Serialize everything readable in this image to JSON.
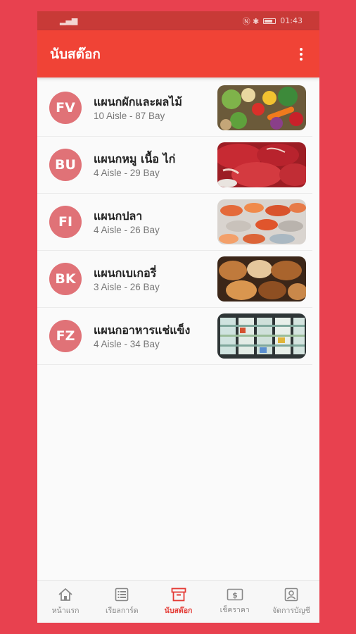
{
  "status_bar": {
    "signal": "▂▄▆",
    "right_icons": "Ⓝ ✱",
    "time": "01:43"
  },
  "app_bar": {
    "title": "นับสต๊อก"
  },
  "departments": [
    {
      "code": "FV",
      "name": "แผนกผักและผลไม้",
      "location": "10 Aisle - 87 Bay",
      "image": "vegetables-image"
    },
    {
      "code": "BU",
      "name": "แผนกหมู เนื้อ ไก่",
      "location": "4 Aisle - 29 Bay",
      "image": "meat-image"
    },
    {
      "code": "FI",
      "name": "แผนกปลา",
      "location": "4 Aisle - 26 Bay",
      "image": "seafood-image"
    },
    {
      "code": "BK",
      "name": "แผนกเบเกอรี่",
      "location": "3 Aisle - 26 Bay",
      "image": "bakery-image"
    },
    {
      "code": "FZ",
      "name": "แผนกอาหารแช่แข็ง",
      "location": "4 Aisle - 34 Bay",
      "image": "frozen-food-image"
    }
  ],
  "bottom_nav": [
    {
      "label": "หน้าแรก",
      "icon": "home-icon",
      "active": false
    },
    {
      "label": "เรียลการ์ด",
      "icon": "list-icon",
      "active": false
    },
    {
      "label": "นับสต๊อก",
      "icon": "archive-box-icon",
      "active": true
    },
    {
      "label": "เช็คราคา",
      "icon": "price-tag-icon",
      "active": false
    },
    {
      "label": "จัดการบัญชี",
      "icon": "account-icon",
      "active": false
    }
  ],
  "colors": {
    "accent": "#f04336",
    "avatar": "#e07277",
    "background": "#e8414f"
  }
}
